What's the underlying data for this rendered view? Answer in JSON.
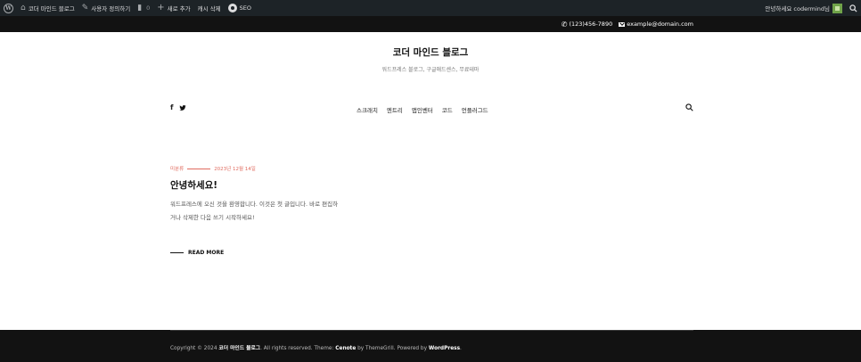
{
  "admin_bar": {
    "site_name": "코더 마인드 블로그",
    "customize": "사용자 정의하기",
    "comments_count": "0",
    "new_post": "새로 추가",
    "cache_delete": "캐시 삭제",
    "seo": "SEO",
    "greeting": "안녕하세요 codermind님"
  },
  "top_bar": {
    "phone": "(123)456-7890",
    "email": "example@domain.com"
  },
  "header": {
    "site_title": "코더 마인드 블로그",
    "tagline": "워드프레스 블로그, 구글애드센스, 무료테마"
  },
  "nav": {
    "items": [
      "스크래치",
      "엔트리",
      "앱인벤터",
      "코드",
      "언플러그드"
    ]
  },
  "post": {
    "category": "미분류",
    "date": "2023년 12월 14일",
    "title": "안녕하세요!",
    "excerpt": "워드프레스에 오신 것을 환영합니다. 이것은 첫 글입니다. 바로 편집하거나 삭제한 다음 쓰기 시작하세요!",
    "read_more": "READ MORE"
  },
  "footer": {
    "prefix": "Copyright © 2024",
    "site": "코더 마인드 블로그",
    "rights": ". All rights reserved. Theme:",
    "theme": "Cenote",
    "by": "by ThemeGrill. Powered by",
    "powered": "WordPress",
    "end": "."
  },
  "colors": {
    "admin_bar_bg": "#1d2327",
    "top_bar_bg": "#121212",
    "accent": "#e06b5f",
    "footer_bg": "#121212"
  }
}
